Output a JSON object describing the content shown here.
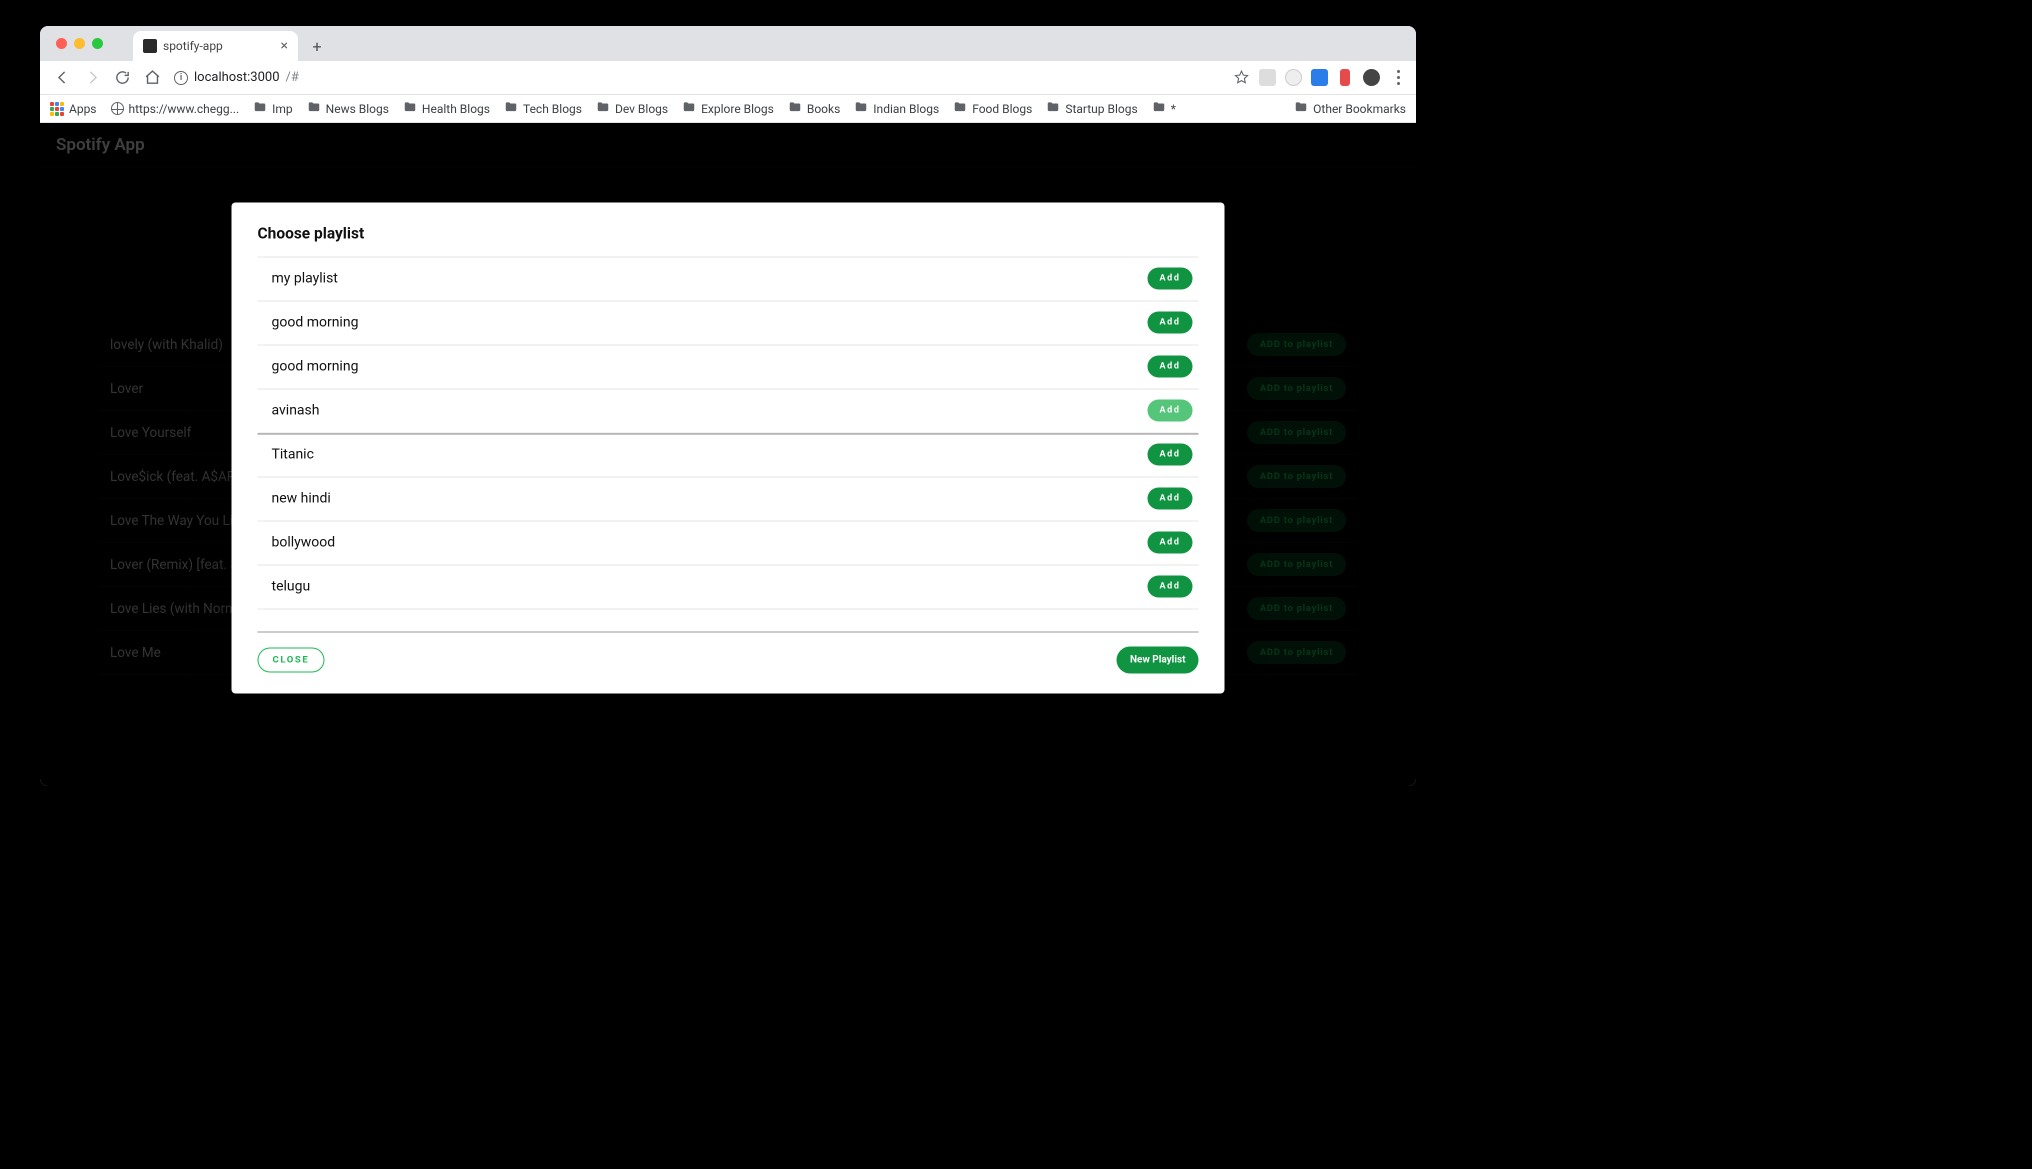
{
  "browser": {
    "tab_title": "spotify-app",
    "url": {
      "host": "localhost:3000",
      "path": "/#"
    },
    "bookmarks_label_apps": "Apps",
    "bookmarks": [
      {
        "type": "globe",
        "label": "https://www.chegg..."
      },
      {
        "type": "folder",
        "label": "Imp"
      },
      {
        "type": "folder",
        "label": "News Blogs"
      },
      {
        "type": "folder",
        "label": "Health Blogs"
      },
      {
        "type": "folder",
        "label": "Tech Blogs"
      },
      {
        "type": "folder",
        "label": "Dev Blogs"
      },
      {
        "type": "folder",
        "label": "Explore Blogs"
      },
      {
        "type": "folder",
        "label": "Books"
      },
      {
        "type": "folder",
        "label": "Indian Blogs"
      },
      {
        "type": "folder",
        "label": "Food Blogs"
      },
      {
        "type": "folder",
        "label": "Startup Blogs"
      },
      {
        "type": "folder",
        "label": "*"
      }
    ],
    "other_bookmarks_label": "Other Bookmarks"
  },
  "app": {
    "header_title": "Spotify App",
    "add_to_playlist_label": "ADD to playlist",
    "songs": [
      "lovely (with Khalid)",
      "Lover",
      "Love Yourself",
      "Love$ick (feat. A$AP Ro",
      "Love The Way You Lie",
      "Lover (Remix) [feat. Sha",
      "Love Lies (with Normani",
      "Love Me"
    ]
  },
  "modal": {
    "title": "Choose playlist",
    "add_label": "Add",
    "close_label": "CLOSE",
    "new_playlist_label": "New Playlist",
    "playlists": [
      {
        "name": "my playlist",
        "hover": false,
        "hl": false
      },
      {
        "name": "good morning",
        "hover": false,
        "hl": false
      },
      {
        "name": "good morning",
        "hover": false,
        "hl": false
      },
      {
        "name": "avinash",
        "hover": true,
        "hl": true
      },
      {
        "name": "Titanic",
        "hover": false,
        "hl": false
      },
      {
        "name": "new hindi",
        "hover": false,
        "hl": false
      },
      {
        "name": "bollywood",
        "hover": false,
        "hl": false
      },
      {
        "name": "telugu",
        "hover": false,
        "hl": false
      }
    ]
  }
}
